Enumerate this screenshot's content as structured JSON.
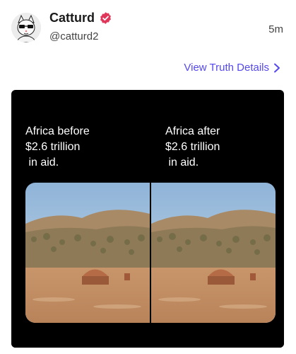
{
  "post": {
    "display_name": "Catturd",
    "handle": "@catturd2",
    "timestamp": "5m",
    "details_link": "View Truth Details"
  },
  "media": {
    "left_caption": [
      "Africa before",
      "$2.6 trillion",
      " in aid."
    ],
    "right_caption": [
      "Africa after",
      "$2.6 trillion",
      " in aid."
    ],
    "left_image": "savanna-village-photo",
    "right_image": "savanna-village-photo"
  },
  "colors": {
    "link": "#5448ee",
    "verified_badge": "#e0365a",
    "media_background": "#000000"
  }
}
